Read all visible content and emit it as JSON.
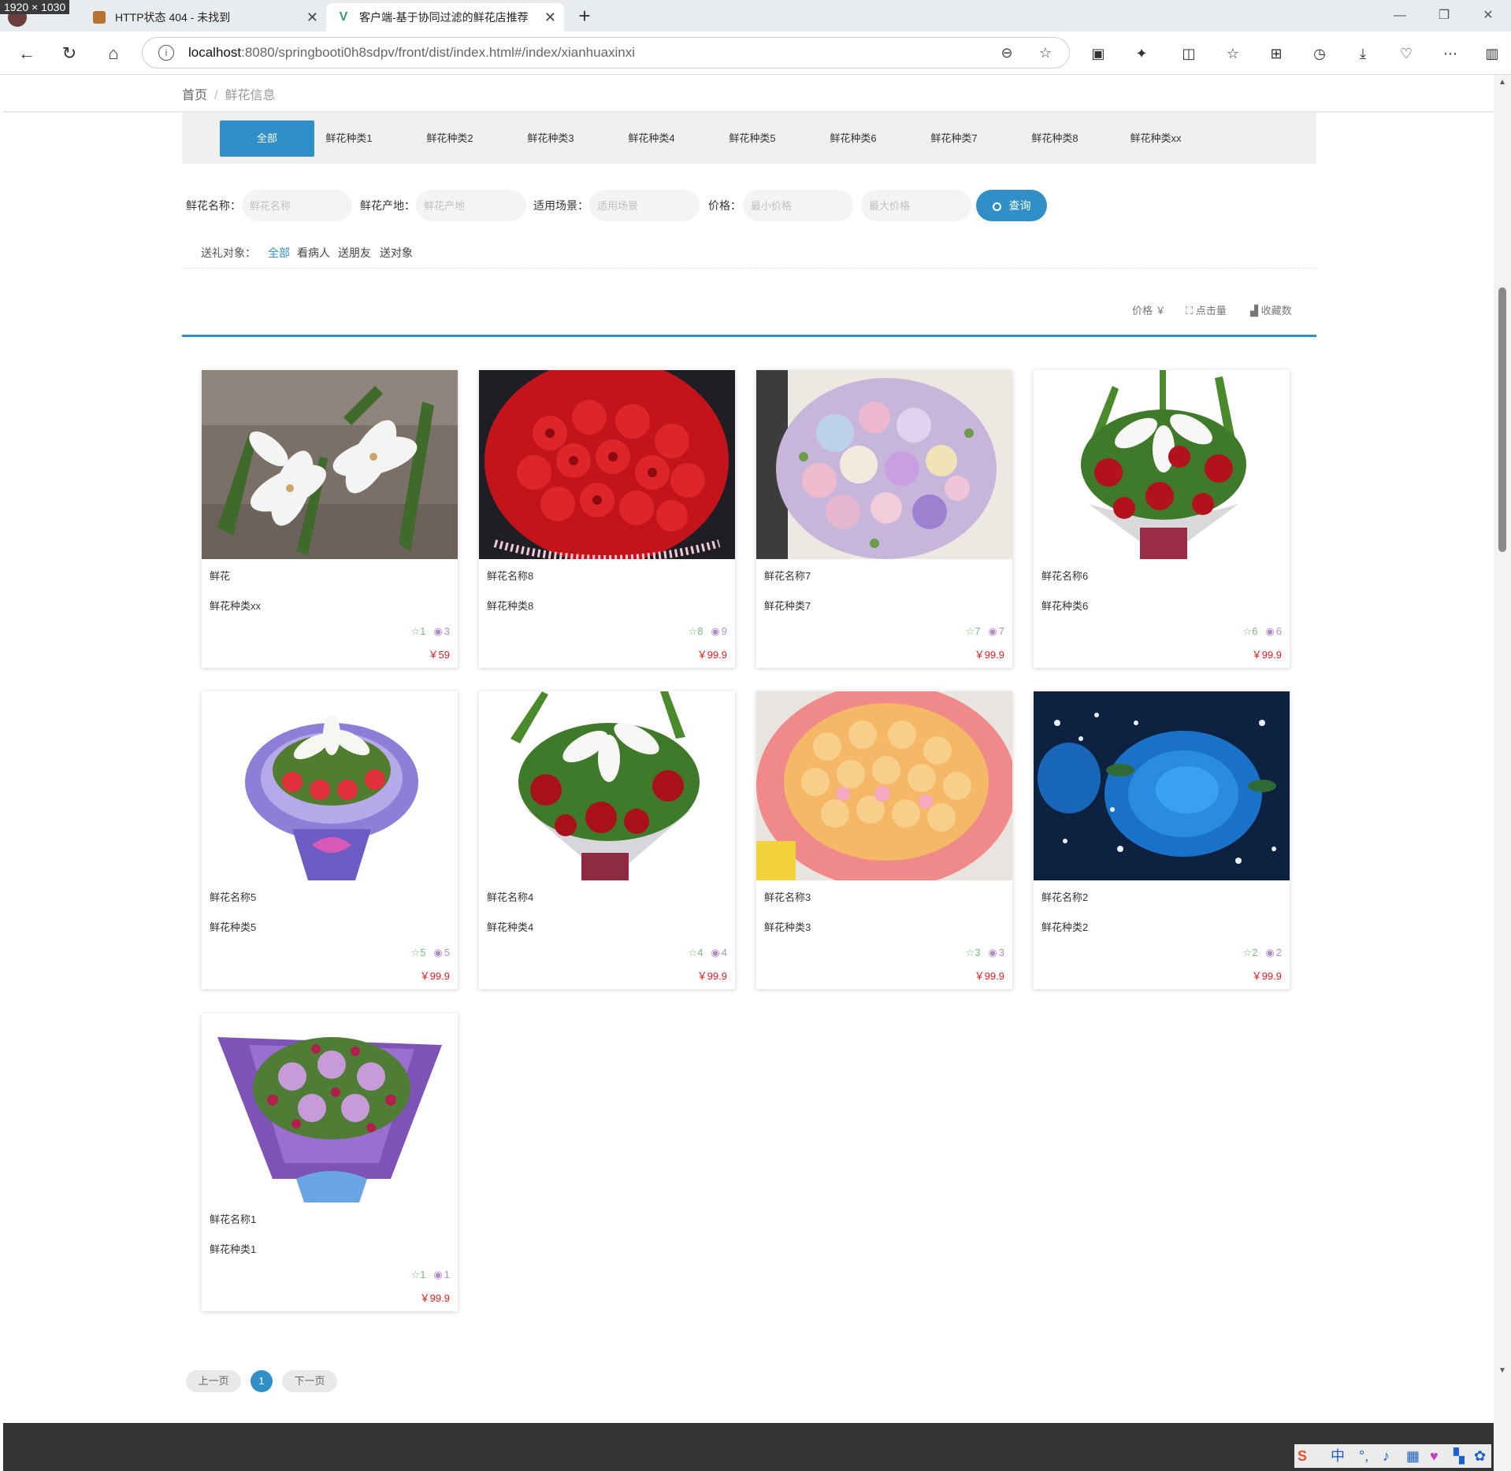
{
  "screen_badge": "1920 × 1030",
  "tabs": [
    {
      "title": "HTTP状态 404 - 未找到"
    },
    {
      "title": "客户端-基于协同过滤的鲜花店推荐"
    }
  ],
  "address": {
    "host": "localhost",
    "rest": ":8080/springbooti0h8sdpv/front/dist/index.html#/index/xianhuaxinxi"
  },
  "breadcrumb": {
    "home": "首页",
    "sep": "/",
    "current": "鲜花信息"
  },
  "categories": [
    "全部",
    "鲜花种类1",
    "鲜花种类2",
    "鲜花种类3",
    "鲜花种类4",
    "鲜花种类5",
    "鲜花种类6",
    "鲜花种类7",
    "鲜花种类8",
    "鲜花种类xx"
  ],
  "filters": {
    "name_label": "鲜花名称：",
    "name_placeholder": "鲜花名称",
    "origin_label": "鲜花产地：",
    "origin_placeholder": "鲜花产地",
    "scene_label": "适用场景：",
    "scene_placeholder": "适用场景",
    "price_label": "价格：",
    "min_placeholder": "最小价格",
    "max_placeholder": "最大价格",
    "search_label": "查询"
  },
  "gift": {
    "label": "送礼对象：",
    "options": [
      "全部",
      "看病人",
      "送朋友",
      "送对象"
    ]
  },
  "sort": {
    "price": "价格 ￥",
    "clicks": "点击量",
    "favorites": "收藏数"
  },
  "products": [
    {
      "name": "鲜花",
      "category": "鲜花种类xx",
      "favorites": "1",
      "views": "3",
      "price": "￥59",
      "image": "white-lily-photo"
    },
    {
      "name": "鲜花名称8",
      "category": "鲜花种类8",
      "favorites": "8",
      "views": "9",
      "price": "￥99.9",
      "image": "red-roses-bouquet-photo"
    },
    {
      "name": "鲜花名称7",
      "category": "鲜花种类7",
      "favorites": "7",
      "views": "7",
      "price": "￥99.9",
      "image": "pastel-mixed-bouquet-photo"
    },
    {
      "name": "鲜花名称6",
      "category": "鲜花种类6",
      "favorites": "6",
      "views": "6",
      "price": "￥99.9",
      "image": "lily-rose-bouquet-photo"
    },
    {
      "name": "鲜花名称5",
      "category": "鲜花种类5",
      "favorites": "5",
      "views": "5",
      "price": "￥99.9",
      "image": "purple-wrapped-bouquet-photo"
    },
    {
      "name": "鲜花名称4",
      "category": "鲜花种类4",
      "favorites": "4",
      "views": "4",
      "price": "￥99.9",
      "image": "lily-red-rose-bouquet-photo"
    },
    {
      "name": "鲜花名称3",
      "category": "鲜花种类3",
      "favorites": "3",
      "views": "3",
      "price": "￥99.9",
      "image": "champagne-roses-bouquet-photo"
    },
    {
      "name": "鲜花名称2",
      "category": "鲜花种类2",
      "favorites": "2",
      "views": "2",
      "price": "￥99.9",
      "image": "blue-rose-photo"
    },
    {
      "name": "鲜花名称1",
      "category": "鲜花种类1",
      "favorites": "1",
      "views": "1",
      "price": "￥99.9",
      "image": "purple-roses-bouquet-photo"
    }
  ],
  "pager": {
    "prev": "上一页",
    "current": "1",
    "next": "下一页"
  },
  "colors": {
    "accent": "#2f8fc6",
    "price": "#e02020",
    "footer": "#333333"
  }
}
